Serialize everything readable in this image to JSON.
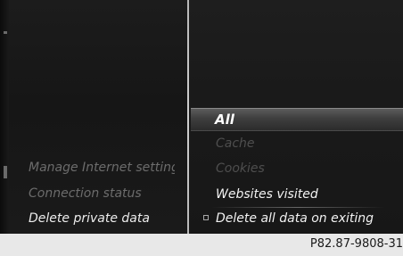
{
  "left_menu": {
    "items": [
      {
        "label": "Manage Internet settings",
        "state": "dim"
      },
      {
        "label": "Connection status",
        "state": "dim"
      },
      {
        "label": "Delete private data",
        "state": "active"
      }
    ]
  },
  "right_menu": {
    "selected": "All",
    "items": [
      {
        "label": "Cache",
        "state": "disabled"
      },
      {
        "label": "Cookies",
        "state": "disabled"
      },
      {
        "label": "Websites visited",
        "state": "enabled"
      },
      {
        "label": "Delete all data on exiting",
        "state": "enabled",
        "checkbox": false
      }
    ]
  },
  "footer": {
    "reference": "P82.87-9808-31"
  },
  "colors": {
    "background": "#1a1a1a",
    "text_bright": "#f2f2f2",
    "text_dim": "#6c6c6c",
    "text_disabled": "#4e4e4e",
    "divider": "#c8c8c8",
    "footer_bg": "#e8e8e8"
  }
}
